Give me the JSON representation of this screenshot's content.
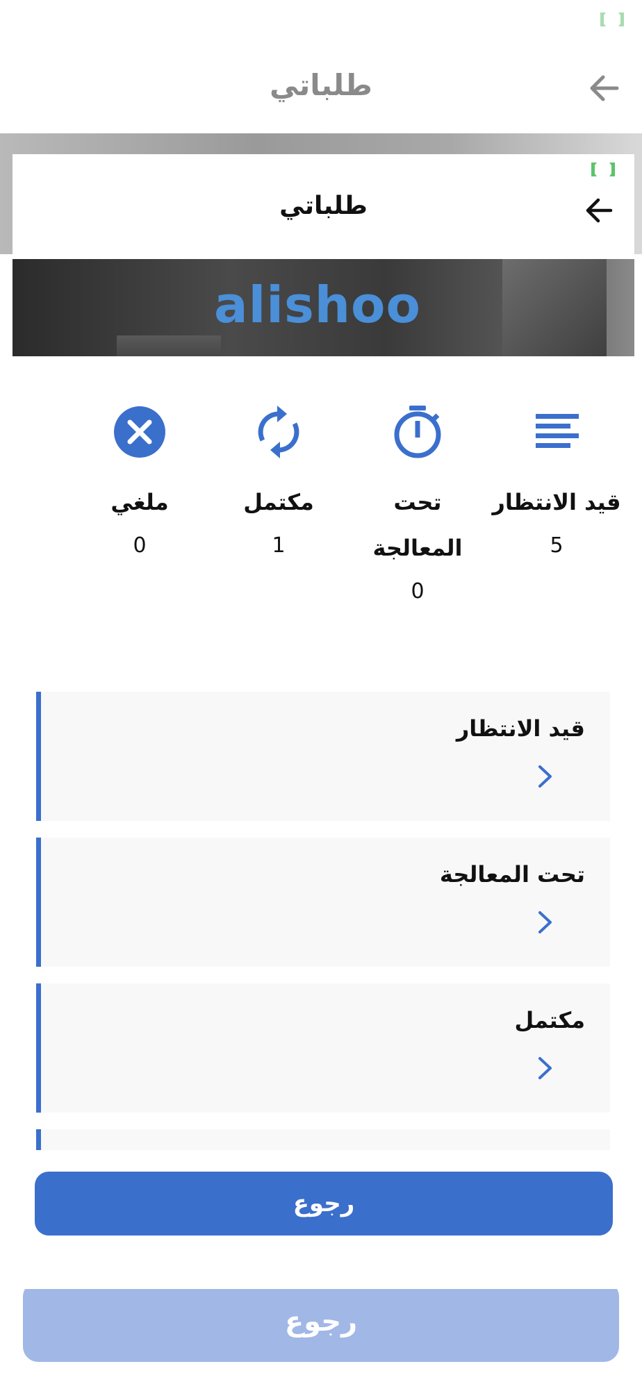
{
  "background_screen": {
    "title": "طلباتي",
    "back_button_label": "رجوع"
  },
  "header": {
    "title": "طلباتي"
  },
  "banner": {
    "logo_text": "alishoo"
  },
  "stats": [
    {
      "label": "قيد الانتظار",
      "count": "5",
      "icon": "list-lines-icon"
    },
    {
      "label": "تحت المعالجة",
      "count": "0",
      "icon": "stopwatch-icon"
    },
    {
      "label": "مكتمل",
      "count": "1",
      "icon": "refresh-icon"
    },
    {
      "label": "ملغي",
      "count": "0",
      "icon": "cancel-circle-icon"
    }
  ],
  "orders_list": [
    {
      "label": "قيد الانتظار"
    },
    {
      "label": "تحت المعالجة"
    },
    {
      "label": "مكتمل"
    }
  ],
  "back_button": {
    "label": "رجوع"
  },
  "colors": {
    "accent": "#3b6fcc",
    "accent_disabled": "#a1b7e6",
    "status_icon": "#5cc46b"
  }
}
